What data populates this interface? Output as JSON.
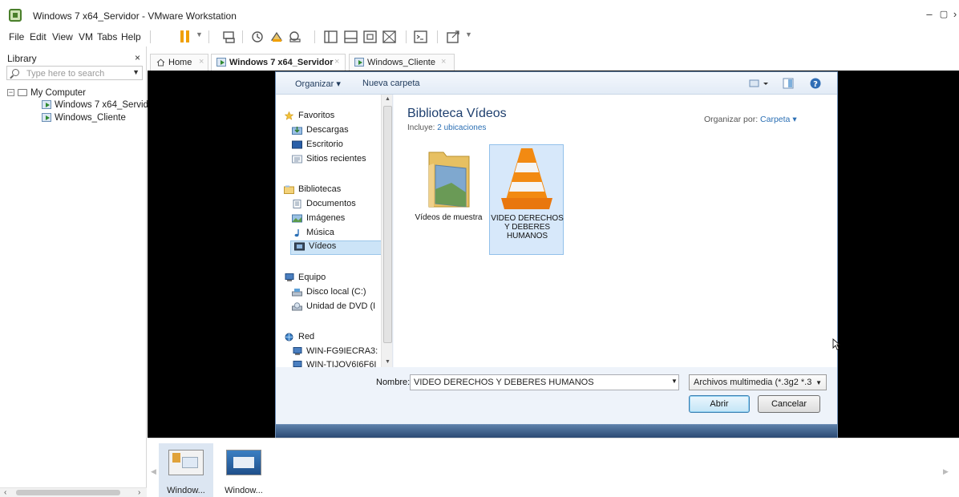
{
  "window": {
    "title": "Windows 7 x64_Servidor - VMware Workstation",
    "controls": [
      "–",
      "▢",
      "›"
    ]
  },
  "menu": [
    "File",
    "Edit",
    "View",
    "VM",
    "Tabs",
    "Help"
  ],
  "library": {
    "title": "Library",
    "close": "×",
    "search_placeholder": "Type here to search",
    "tree": {
      "root": "My Computer",
      "items": [
        "Windows 7 x64_Servidor",
        "Windows_Cliente"
      ]
    },
    "scroll_left": "‹",
    "scroll_right": "›"
  },
  "tabs": [
    {
      "label": "Home",
      "active": false,
      "icon": "home-icon"
    },
    {
      "label": "Windows 7 x64_Servidor",
      "active": true,
      "icon": "vm-icon"
    },
    {
      "label": "Windows_Cliente",
      "active": false,
      "icon": "vm-icon"
    }
  ],
  "dialog": {
    "toolbar": {
      "organize": "Organizar ▾",
      "new_folder": "Nueva carpeta"
    },
    "nav": {
      "favorites": "Favoritos",
      "favorites_items": [
        "Descargas",
        "Escritorio",
        "Sitios recientes"
      ],
      "libraries": "Bibliotecas",
      "libraries_items": [
        "Documentos",
        "Imágenes",
        "Música",
        "Vídeos"
      ],
      "computer": "Equipo",
      "computer_items": [
        "Disco local (C:)",
        "Unidad de DVD (I"
      ],
      "network": "Red",
      "network_items": [
        "WIN-FG9IECRA3:",
        "WIN-TIJOV6I6F6I"
      ]
    },
    "content": {
      "heading": "Biblioteca Vídeos",
      "includes_label": "Incluye:",
      "includes_value": "2 ubicaciones",
      "arrange_label": "Organizar por:",
      "arrange_value": "Carpeta ▾",
      "files": [
        {
          "label": "Vídeos de muestra",
          "icon": "folder-icon",
          "selected": false
        },
        {
          "label": "VIDEO DERECHOS Y DEBERES HUMANOS",
          "icon": "vlc-cone-icon",
          "selected": true
        }
      ]
    },
    "filename_label": "Nombre:",
    "filename_value": "VIDEO DERECHOS Y DEBERES HUMANOS",
    "filetype_value": "Archivos multimedia (*.3g2 *.3",
    "open_button": "Abrir",
    "cancel_button": "Cancelar",
    "selected_nav": "Vídeos"
  },
  "thumbnails": [
    {
      "label": "Window...",
      "selected": true
    },
    {
      "label": "Window...",
      "selected": false
    }
  ],
  "colors": {
    "accent": "#2b6fb4",
    "heading": "#1e3f6e",
    "pause": "#f0a000",
    "guest_bg": "#000000"
  }
}
